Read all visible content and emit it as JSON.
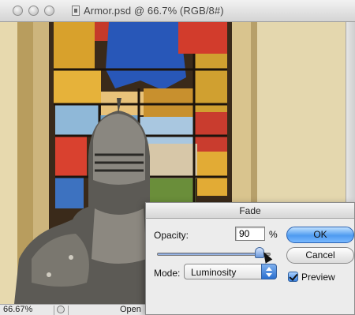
{
  "window": {
    "title": "Armor.psd @ 66.7% (RGB/8#)"
  },
  "status_bar": {
    "zoom": "66.67%",
    "info": "Open"
  },
  "fade_dialog": {
    "title": "Fade",
    "opacity_label": "Opacity:",
    "opacity_value": "90",
    "opacity_unit": "%",
    "opacity_fraction": 0.9,
    "mode_label": "Mode:",
    "mode_value": "Luminosity",
    "ok_label": "OK",
    "cancel_label": "Cancel",
    "preview_label": "Preview",
    "preview_checked": true
  },
  "colors": {
    "accent_blue": "#4e9bf0",
    "glass_blue": "#2a5fb8",
    "glass_red": "#c0392b",
    "glass_gold": "#e3a525",
    "frame_stone": "#cdb57d"
  },
  "icons": {
    "traffic_lights": [
      "close-icon",
      "minimize-icon",
      "zoom-icon"
    ],
    "document": "psd-document-icon",
    "mode_popup": "popup-arrows-icon"
  }
}
